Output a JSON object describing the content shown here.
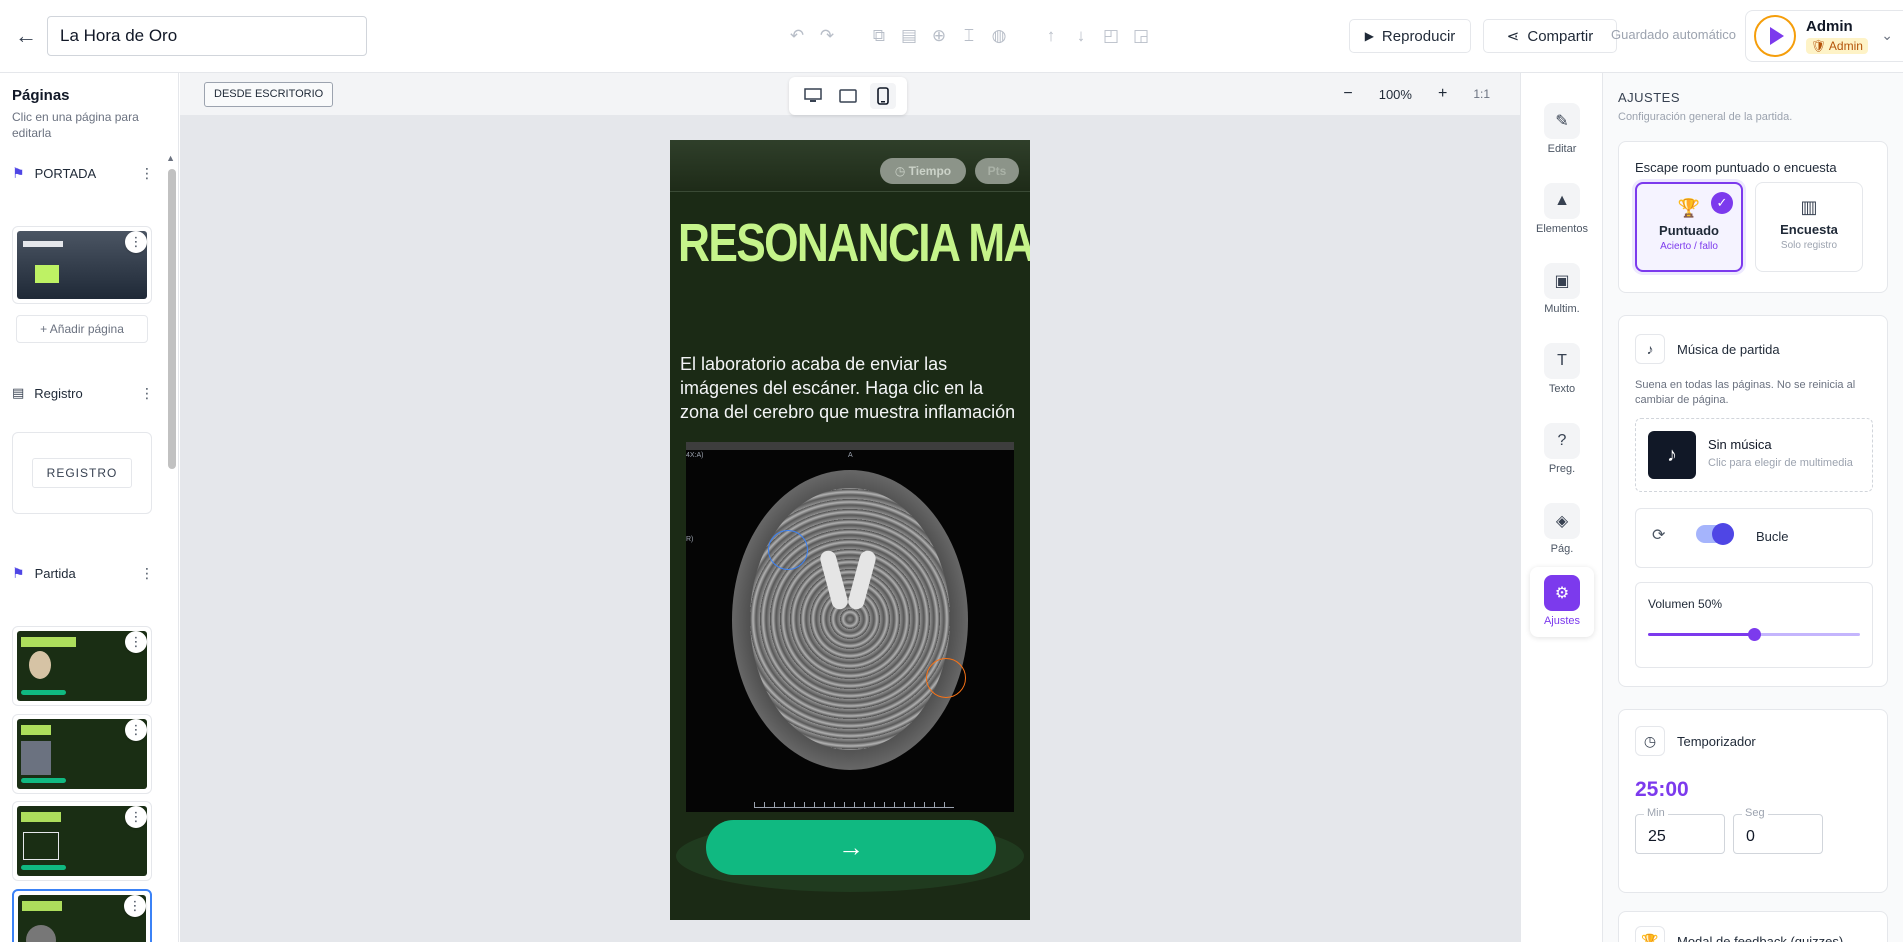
{
  "header": {
    "back_icon": "arrow-left-icon",
    "title_value": "La Hora de Oro",
    "play_label": "Reproducir",
    "share_label": "Compartir",
    "autosave_label": "Guardado automático",
    "user": {
      "name": "Admin",
      "role": "Admin"
    }
  },
  "pages_panel": {
    "title": "Páginas",
    "hint": "Clic en una página para editarla",
    "sections": [
      {
        "name": "PORTADA",
        "icon": "flag-icon"
      },
      {
        "name": "Registro",
        "icon": "clipboard-icon"
      },
      {
        "name": "Partida",
        "icon": "flag-icon"
      }
    ],
    "add_page_label": "+ Añadir página",
    "registro_card_label": "REGISTRO"
  },
  "canvas": {
    "from_desktop_label": "DESDE ESCRITORIO",
    "zoom_level": "100%",
    "zoom_reset": "1:1",
    "zoom_minus": "−",
    "zoom_plus": "+"
  },
  "phone": {
    "timer_label": "Tiempo",
    "points_label": "Pts",
    "title": "RESONANCIA MAGNÉTICA",
    "body": "El laboratorio acaba de enviar las imágenes del escáner. Haga clic en la zona del cerebro que muestra inflamación beneficiosa",
    "scan_tl": "4X:A)",
    "scan_top": "A",
    "scan_left": "R)",
    "next_icon": "→"
  },
  "rail": {
    "items": [
      {
        "label": "Editar",
        "icon": "pencil-icon",
        "glyph": "✎"
      },
      {
        "label": "Elementos",
        "icon": "shapes-icon",
        "glyph": "▲"
      },
      {
        "label": "Multim.",
        "icon": "image-icon",
        "glyph": "▣"
      },
      {
        "label": "Texto",
        "icon": "text-icon",
        "glyph": "T"
      },
      {
        "label": "Preg.",
        "icon": "question-icon",
        "glyph": "?"
      },
      {
        "label": "Pág.",
        "icon": "layers-icon",
        "glyph": "◈"
      },
      {
        "label": "Ajustes",
        "icon": "gear-icon",
        "glyph": "⚙"
      }
    ]
  },
  "settings": {
    "title": "AJUSTES",
    "subtitle": "Configuración general de la partida.",
    "mode": {
      "label": "Escape room puntuado o encuesta",
      "options": [
        {
          "name": "Puntuado",
          "desc": "Acierto / fallo",
          "selected": true
        },
        {
          "name": "Encuesta",
          "desc": "Solo registro",
          "selected": false
        }
      ]
    },
    "music": {
      "label": "Música de partida",
      "hint": "Suena en todas las páginas. No se reinicia al cambiar de página.",
      "none_title": "Sin música",
      "none_desc": "Clic para elegir de multimedia",
      "loop_label": "Bucle",
      "volume_label": "Volumen 50%",
      "volume": 0.5
    },
    "timer": {
      "label": "Temporizador",
      "display": "25:00",
      "min_label": "Min",
      "min_value": "25",
      "sec_label": "Seg",
      "sec_value": "0"
    },
    "feedback": {
      "label": "Modal de feedback (quizzes)"
    }
  }
}
